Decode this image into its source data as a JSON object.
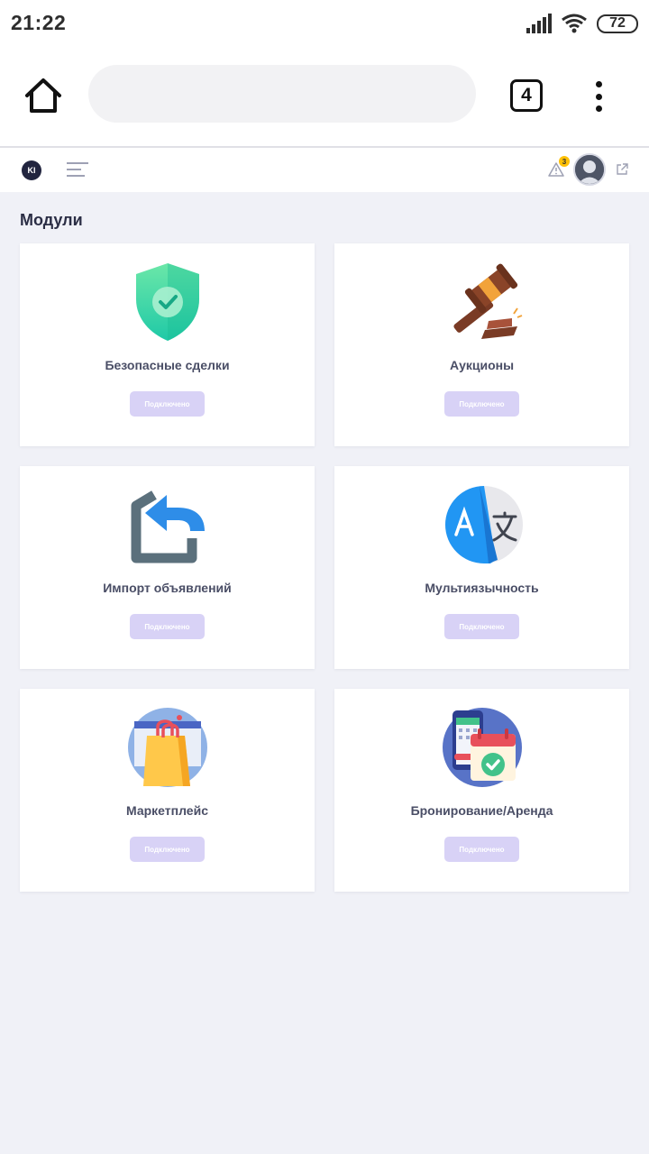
{
  "status_bar": {
    "time": "21:22",
    "battery": "72"
  },
  "browser": {
    "url": "",
    "tab_count": "4"
  },
  "app_header": {
    "logo_text": "KI",
    "alert_count": "3"
  },
  "page": {
    "title": "Модули"
  },
  "modules": [
    {
      "title": "Безопасные сделки",
      "button": "Подключено",
      "icon": "shield-check-icon"
    },
    {
      "title": "Аукционы",
      "button": "Подключено",
      "icon": "gavel-icon"
    },
    {
      "title": "Импорт объявлений",
      "button": "Подключено",
      "icon": "import-icon"
    },
    {
      "title": "Мультиязычность",
      "button": "Подключено",
      "icon": "translate-icon"
    },
    {
      "title": "Маркетплейс",
      "button": "Подключено",
      "icon": "shopping-bag-icon"
    },
    {
      "title": "Бронирование/Аренда",
      "button": "Подключено",
      "icon": "booking-calendar-icon"
    }
  ],
  "colors": {
    "page_background": "#f0f1f7",
    "button_connected": "#d8d2f6",
    "alert_badge": "#ffc107",
    "shield_green": "#3ecf8e",
    "translate_blue": "#2196f3"
  }
}
